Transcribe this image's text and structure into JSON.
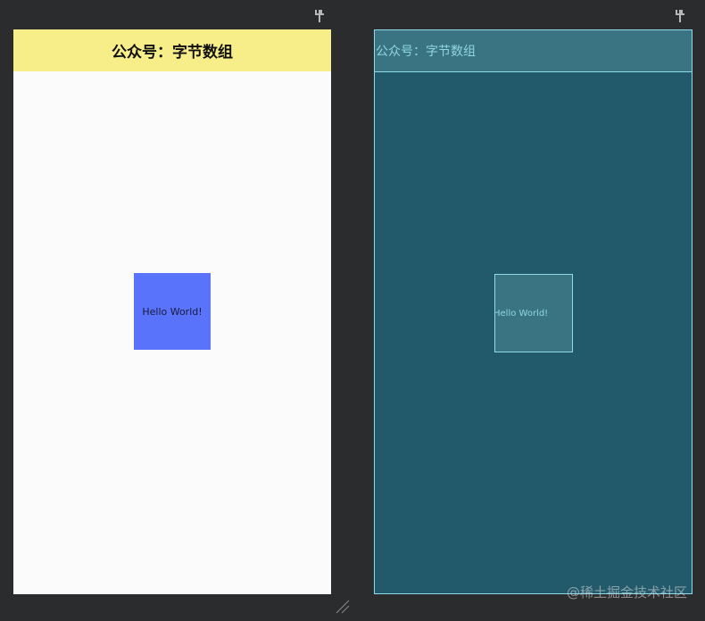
{
  "design_preview": {
    "header_title": "公众号：字节数组",
    "hello_text": "Hello World!",
    "header_color": "#f8ee89",
    "box_color": "#5a73fb",
    "background_color": "#fbfbfb"
  },
  "blueprint_preview": {
    "header_title": "公众号：字节数组",
    "hello_text": "Hello World!",
    "background_color": "#235a6b",
    "outline_color": "#8fdbea"
  },
  "icons": {
    "pin": "pin-icon",
    "resize": "resize-handle-icon"
  },
  "watermark": "@稀土掘金技术社区"
}
